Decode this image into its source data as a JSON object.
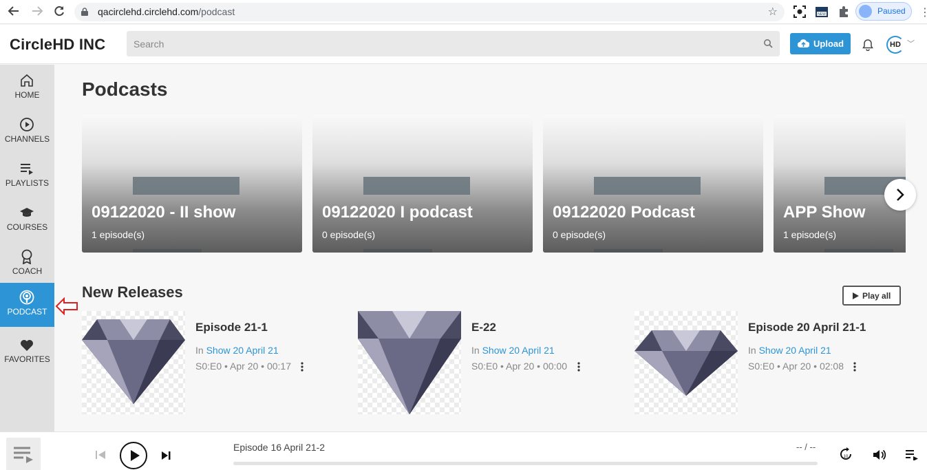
{
  "browser": {
    "url_host": "qacirclehd.circlehd.com",
    "url_path": "/podcast",
    "profile_label": "Paused"
  },
  "header": {
    "brand": "CircleHD INC",
    "search_placeholder": "Search",
    "upload_label": "Upload",
    "logo_text": "HD"
  },
  "sidebar": {
    "items": [
      {
        "label": "HOME",
        "icon": "home-icon"
      },
      {
        "label": "CHANNELS",
        "icon": "play-circle-icon"
      },
      {
        "label": "PLAYLISTS",
        "icon": "playlist-icon"
      },
      {
        "label": "COURSES",
        "icon": "graduation-cap-icon"
      },
      {
        "label": "COACH",
        "icon": "award-icon"
      },
      {
        "label": "PODCAST",
        "icon": "podcast-icon",
        "active": true
      },
      {
        "label": "FAVORITES",
        "icon": "heart-icon"
      }
    ]
  },
  "main": {
    "title": "Podcasts",
    "podcasts": [
      {
        "title": "09122020 - II show",
        "episodes": "1 episode(s)"
      },
      {
        "title": "09122020 I podcast",
        "episodes": "0 episode(s)"
      },
      {
        "title": "09122020 Podcast",
        "episodes": "0 episode(s)"
      },
      {
        "title": "APP Show",
        "episodes": "1 episode(s)"
      }
    ],
    "new_releases_title": "New Releases",
    "play_all_label": "Play all",
    "releases": [
      {
        "title": "Episode 21-1",
        "in_label": "In",
        "show": "Show 20 April 21",
        "meta": "S0:E0 • Apr 20 • 00:17"
      },
      {
        "title": "E-22",
        "in_label": "In",
        "show": "Show 20 April 21",
        "meta": "S0:E0 • Apr 20 • 00:00"
      },
      {
        "title": "Episode 20 April 21-1",
        "in_label": "In",
        "show": "Show 20 April 21",
        "meta": "S0:E0 • Apr 20 • 02:08"
      }
    ]
  },
  "player": {
    "now_playing": "Episode 16 April 21-2",
    "time": "-- / --",
    "progress": 0
  },
  "colors": {
    "accent": "#2d94d6",
    "sidebar_bg": "#e0e0e0",
    "annotation_red": "#e02020"
  }
}
